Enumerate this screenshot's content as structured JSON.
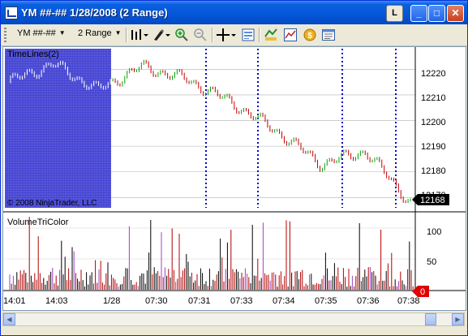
{
  "window": {
    "title": "YM ##-##  1/28/2008 (2 Range)",
    "buttons": {
      "layout_label": "L",
      "minimize": "_",
      "maximize": "□",
      "close": "✕"
    }
  },
  "toolbar": {
    "instrument": "YM ##-##",
    "interval": "2 Range",
    "icons": [
      "bar-type-icon",
      "pen-drawing-icon",
      "zoom-in-icon",
      "zoom-out-icon",
      "crosshair-icon",
      "properties-icon",
      "strategy-icon",
      "indicators-icon",
      "money-icon",
      "data-box-icon"
    ]
  },
  "chart": {
    "upper_panel": {
      "title": "TimeLines(2)",
      "watermark": "© 2008 NinjaTrader, LLC",
      "price_ticks": [
        "12220",
        "12210",
        "12200",
        "12190",
        "12180",
        "12170"
      ],
      "last_price": "12168",
      "colors": {
        "up": "#00a000",
        "down": "#c00000",
        "timelines": "#0000c8",
        "last_price_bg": "#000000"
      }
    },
    "lower_panel": {
      "title": "VolumeTriColor",
      "volume_ticks": [
        "100",
        "50"
      ],
      "last_volume": "0",
      "colors": {
        "black": "#000000",
        "red": "#b00000",
        "purple": "#a040c0",
        "last_volume_bg": "#e00000"
      }
    },
    "time_labels": [
      "14:01",
      "14:03",
      "1/28",
      "07:30",
      "07:31",
      "07:33",
      "07:34",
      "07:35",
      "07:36",
      "07:38"
    ]
  },
  "chart_data": {
    "type": "bar",
    "title": "TimeLines(2)",
    "x": [
      "14:01",
      "14:03",
      "1/28",
      "07:30",
      "07:31",
      "07:33",
      "07:34",
      "07:35",
      "07:36",
      "07:38"
    ],
    "series": [
      {
        "name": "price",
        "values": [
          12215,
          12222,
          12212,
          12221,
          12216,
          12207,
          12196,
          12183,
          12188,
          12168
        ]
      }
    ],
    "ylim": [
      12166,
      12228
    ],
    "volume_ylim": [
      0,
      125
    ],
    "last_price": 12168,
    "last_volume": 0
  }
}
